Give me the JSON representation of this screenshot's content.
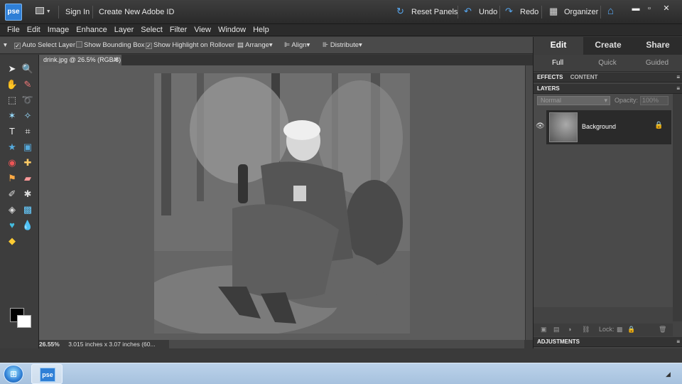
{
  "topbar": {
    "logo": "pse",
    "sign_in": "Sign In",
    "create_id": "Create New Adobe ID",
    "reset_panels": "Reset Panels",
    "undo": "Undo",
    "redo": "Redo",
    "organizer": "Organizer"
  },
  "menu": [
    "File",
    "Edit",
    "Image",
    "Enhance",
    "Layer",
    "Select",
    "Filter",
    "View",
    "Window",
    "Help"
  ],
  "options": {
    "auto_select": "Auto Select Layer",
    "bounding_box": "Show Bounding Box",
    "highlight": "Show Highlight on Rollover",
    "arrange": "Arrange",
    "align": "Align",
    "distribute": "Distribute"
  },
  "document": {
    "tab_label": "drink.jpg @ 26.5% (RGB/8)",
    "zoom": "26.55%",
    "dimensions": "3.015 inches x 3.07 inches (60..."
  },
  "panel": {
    "modes": [
      "Edit",
      "Create",
      "Share"
    ],
    "sub_modes": [
      "Full",
      "Quick",
      "Guided"
    ],
    "effects": "EFFECTS",
    "content": "CONTENT",
    "layers": "LAYERS",
    "blend_mode": "Normal",
    "opacity_label": "Opacity:",
    "opacity_value": "100%",
    "layer_name": "Background",
    "lock_label": "Lock:",
    "adjustments": "ADJUSTMENTS"
  },
  "taskbar": {
    "app": "pse"
  }
}
